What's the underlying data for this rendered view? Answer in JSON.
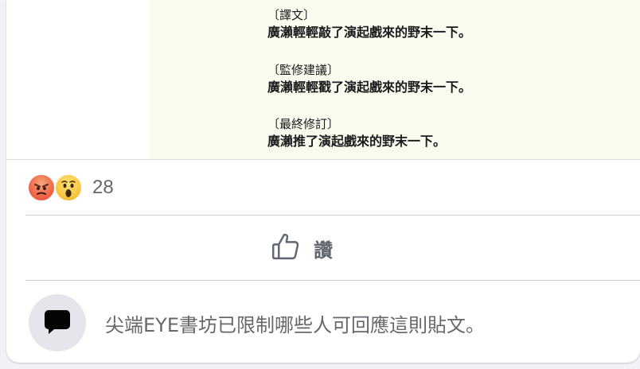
{
  "post_image": {
    "notes": [
      {
        "heading": "〔譯文〕",
        "body": "廣瀨輕輕敲了演起戲來的野末一下。"
      },
      {
        "heading": "〔監修建議〕",
        "body": "廣瀨輕輕戳了演起戲來的野末一下。"
      },
      {
        "heading": "〔最終修訂〕",
        "body": "廣瀨推了演起戲來的野末一下。"
      }
    ]
  },
  "reactions": {
    "icons": [
      "angry-reaction-icon",
      "wow-reaction-icon"
    ],
    "count": "28"
  },
  "actions": {
    "like_label": "讚"
  },
  "comments": {
    "restriction_text": "尖端EYE書坊已限制哪些人可回應這則貼文。"
  },
  "colors": {
    "image_background": "#fbfaee",
    "secondary_text": "#65676b",
    "divider": "#ced0d4"
  }
}
